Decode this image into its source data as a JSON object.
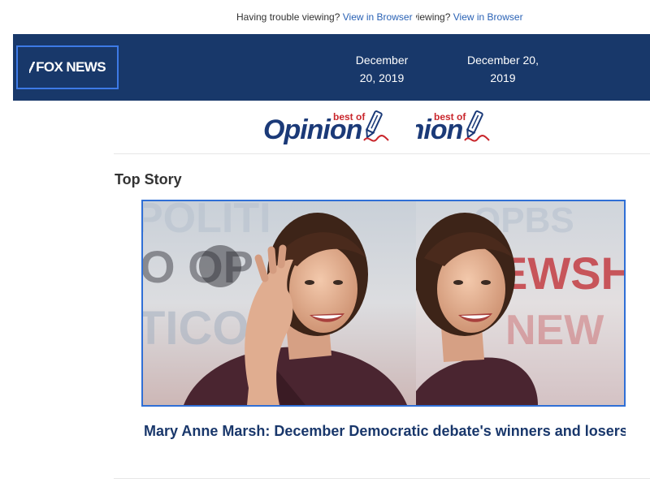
{
  "preheader": {
    "text": "Having trouble viewing? ",
    "link": "View in Browser"
  },
  "header": {
    "logo": "FOX NEWS",
    "date": "December 20, 2019"
  },
  "opinion_logo": {
    "best_of": "best of",
    "word": "Opinion",
    "word_fragment": "inion"
  },
  "section": {
    "label": "Top Story"
  },
  "story": {
    "headline": "Mary Anne Marsh: December Democratic debate's winners and losers – (Hint: You may be surprised)"
  },
  "colors": {
    "header_bg": "#18386a",
    "link": "#2a62b5",
    "headline": "#19376b",
    "accent_red": "#c9262c"
  }
}
